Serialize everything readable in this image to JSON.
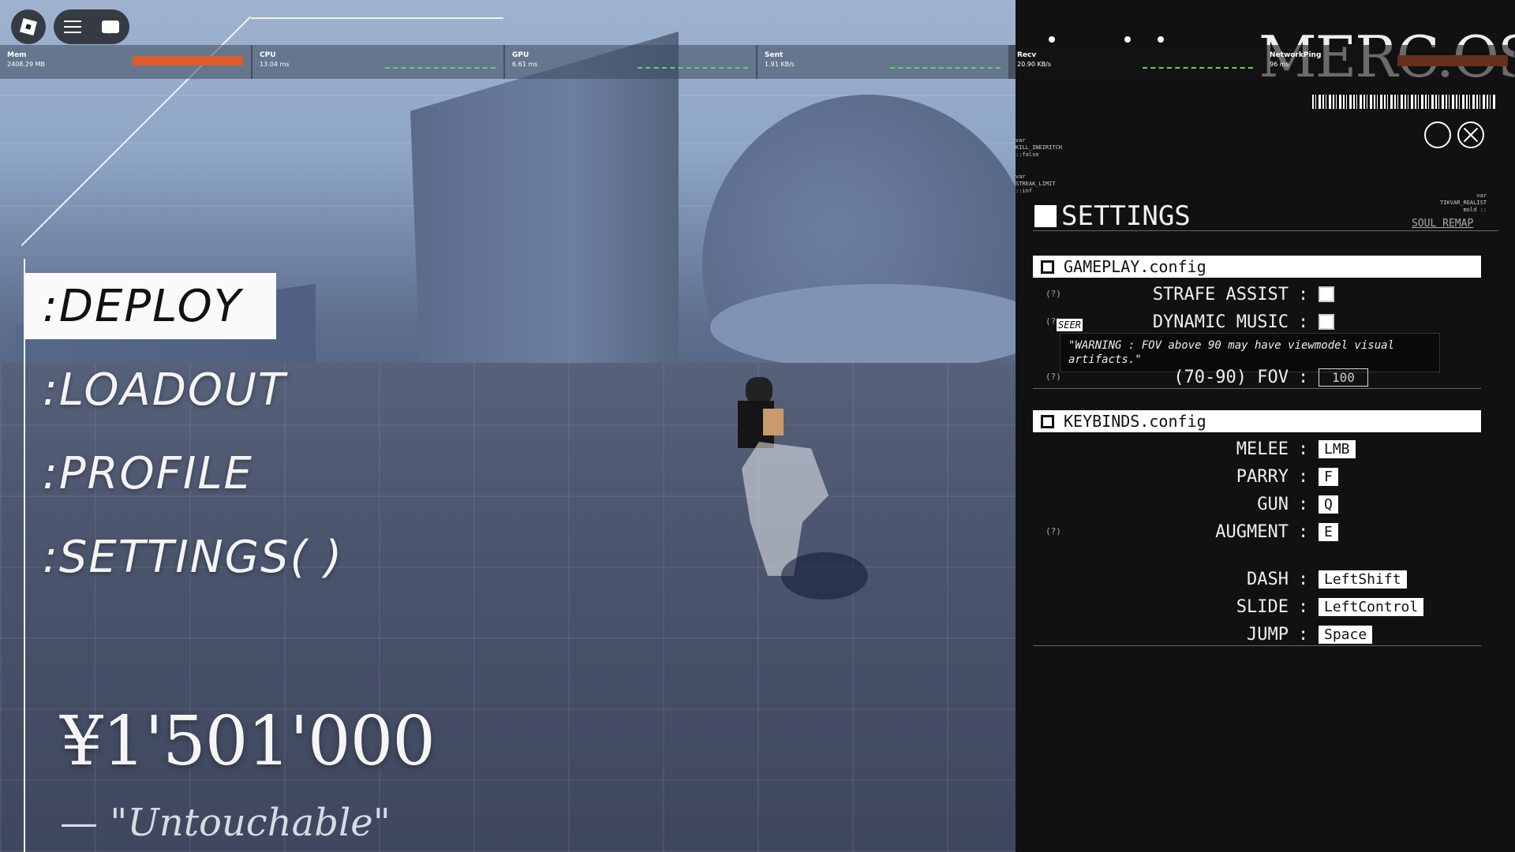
{
  "stats": [
    {
      "name": "Mem",
      "value": "2408.29 MB",
      "kind": "bar"
    },
    {
      "name": "CPU",
      "value": "13.04 ms",
      "kind": "graph"
    },
    {
      "name": "GPU",
      "value": "6.61 ms",
      "kind": "graph"
    },
    {
      "name": "Sent",
      "value": "1.91 KB/s",
      "kind": "graph"
    },
    {
      "name": "Recv",
      "value": "20.90 KB/s",
      "kind": "graph"
    },
    {
      "name": "NetworkPing",
      "value": "96 ms",
      "kind": "bar"
    }
  ],
  "menu": {
    "deploy": ":DEPLOY",
    "loadout": ":LOADOUT",
    "profile": ":PROFILE",
    "settings": ":SETTINGS( )"
  },
  "player": {
    "money": "¥1'501'000",
    "title": "— \"Untouchable\""
  },
  "panel": {
    "logo": "MERC.OS",
    "settings_title": "SETTINGS",
    "soul_remap": "SOUL REMAP",
    "var1": "var\nKILL_INEIRITCH\n::false",
    "var2": "var\nSTREAK_LIMIT\n::inf",
    "var3": "var\nTIKVAR_REALIST\nmold ::"
  },
  "gameplay": {
    "header": "GAMEPLAY.config",
    "strafe_assist": "STRAFE ASSIST",
    "dynamic_music": "DYNAMIC MUSIC",
    "fov_label": "(70-90) FOV",
    "fov_value": "100",
    "help": "(?)",
    "seer": "SEER",
    "warning": "\"WARNING : FOV above 90 may have viewmodel visual artifacts.\""
  },
  "keybinds": {
    "header": "KEYBINDS.config",
    "rows": [
      {
        "action": "MELEE",
        "key": "LMB"
      },
      {
        "action": "PARRY",
        "key": "F"
      },
      {
        "action": "GUN",
        "key": "Q"
      },
      {
        "action": "AUGMENT",
        "key": "E"
      },
      {
        "action": "DASH",
        "key": "LeftShift"
      },
      {
        "action": "SLIDE",
        "key": "LeftControl"
      },
      {
        "action": "JUMP",
        "key": "Space"
      }
    ],
    "colon": ":"
  },
  "colors": {
    "accent": "#e05a2a",
    "graph": "#5bd65b",
    "panel_bg": "#111112"
  }
}
